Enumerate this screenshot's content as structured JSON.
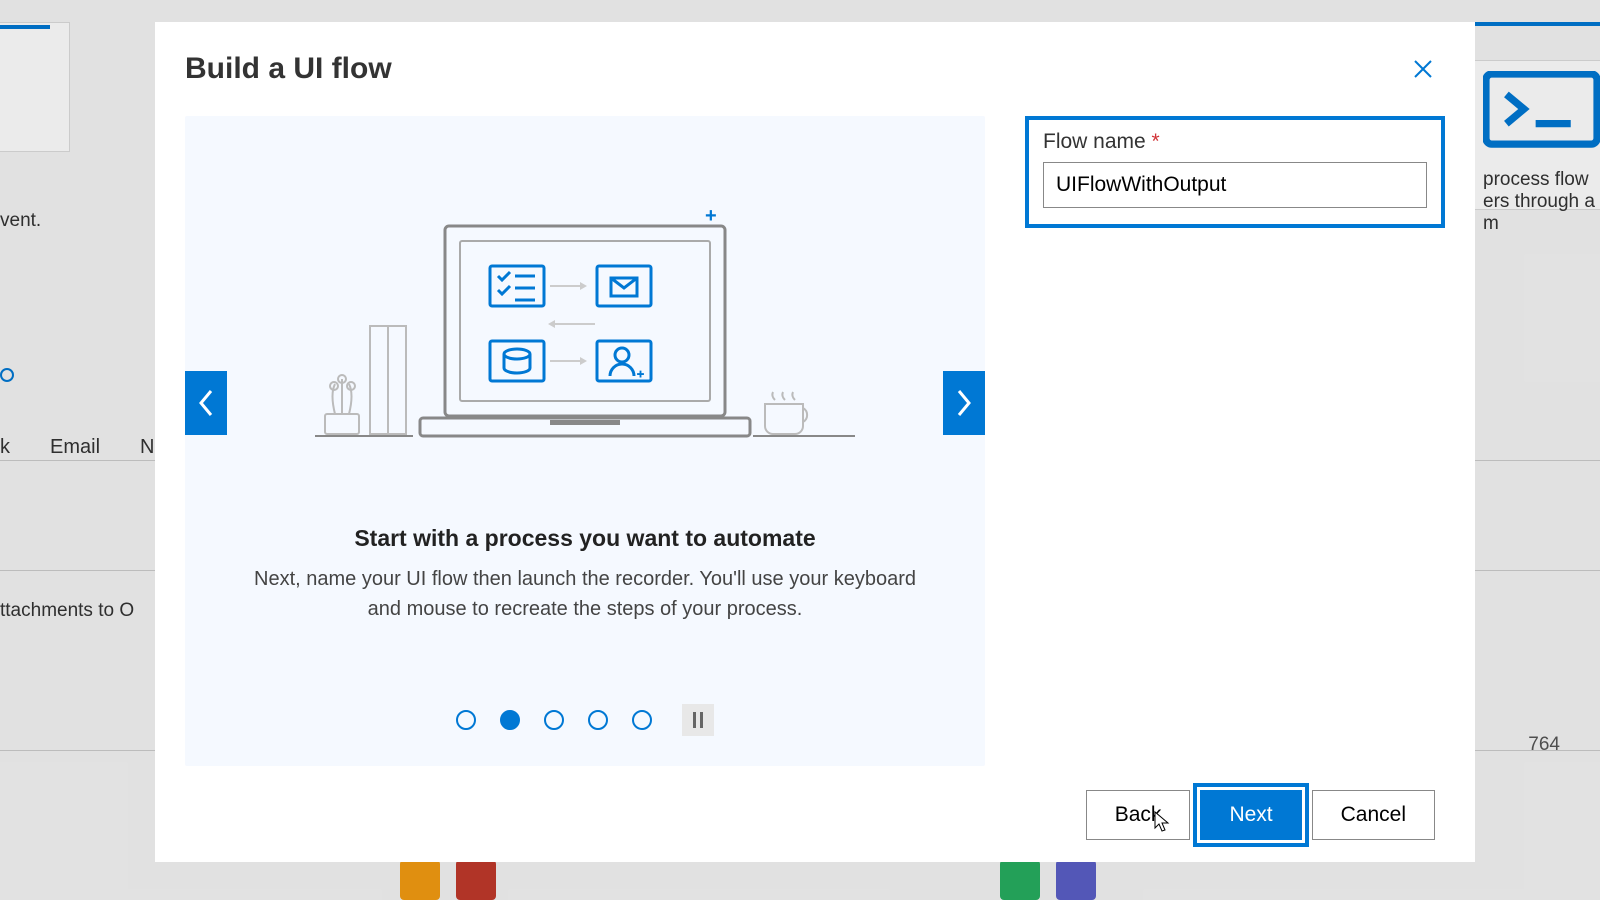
{
  "background": {
    "event_text": "vent.",
    "tab_k": "k",
    "tab_email": "Email",
    "tab_n": "N",
    "attachments": "ttachments to O",
    "card_tr_line1": "process flow",
    "card_tr_line2": "ers through a m",
    "number": "764"
  },
  "modal": {
    "title": "Build a UI flow",
    "carousel": {
      "heading": "Start with a process you want to automate",
      "subtext": "Next, name your UI flow then launch the recorder. You'll use your keyboard and mouse to recreate the steps of your process.",
      "active_slide": 2,
      "total_slides": 5
    },
    "form": {
      "label": "Flow name",
      "required_mark": "*",
      "value": "UIFlowWithOutput"
    },
    "footer": {
      "back": "Back",
      "next": "Next",
      "cancel": "Cancel"
    }
  }
}
